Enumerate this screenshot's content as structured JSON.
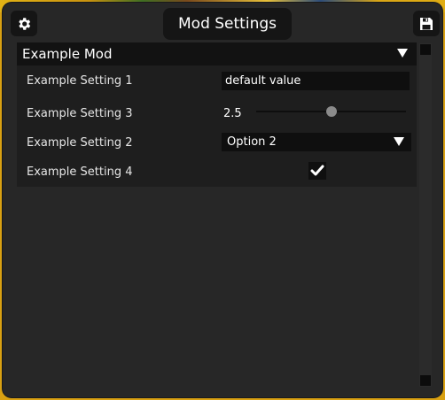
{
  "window": {
    "title": "Mod Settings"
  },
  "icons": {
    "settings": "gear-icon",
    "save": "floppy-disk-icon"
  },
  "mod": {
    "name": "Example Mod",
    "settings": [
      {
        "label": "Example Setting 1",
        "type": "text",
        "value": "default value"
      },
      {
        "label": "Example Setting 3",
        "type": "slider",
        "value": "2.5",
        "fill_fraction": 0.5
      },
      {
        "label": "Example Setting 2",
        "type": "select",
        "value": "Option 2"
      },
      {
        "label": "Example Setting 4",
        "type": "checkbox",
        "checked": true
      }
    ]
  },
  "colors": {
    "window_bg": "#272727",
    "panel_bg": "#1e1e1e",
    "header_bg": "#121212",
    "text": "#ffffff",
    "slider_thumb": "#8b8b8b"
  }
}
